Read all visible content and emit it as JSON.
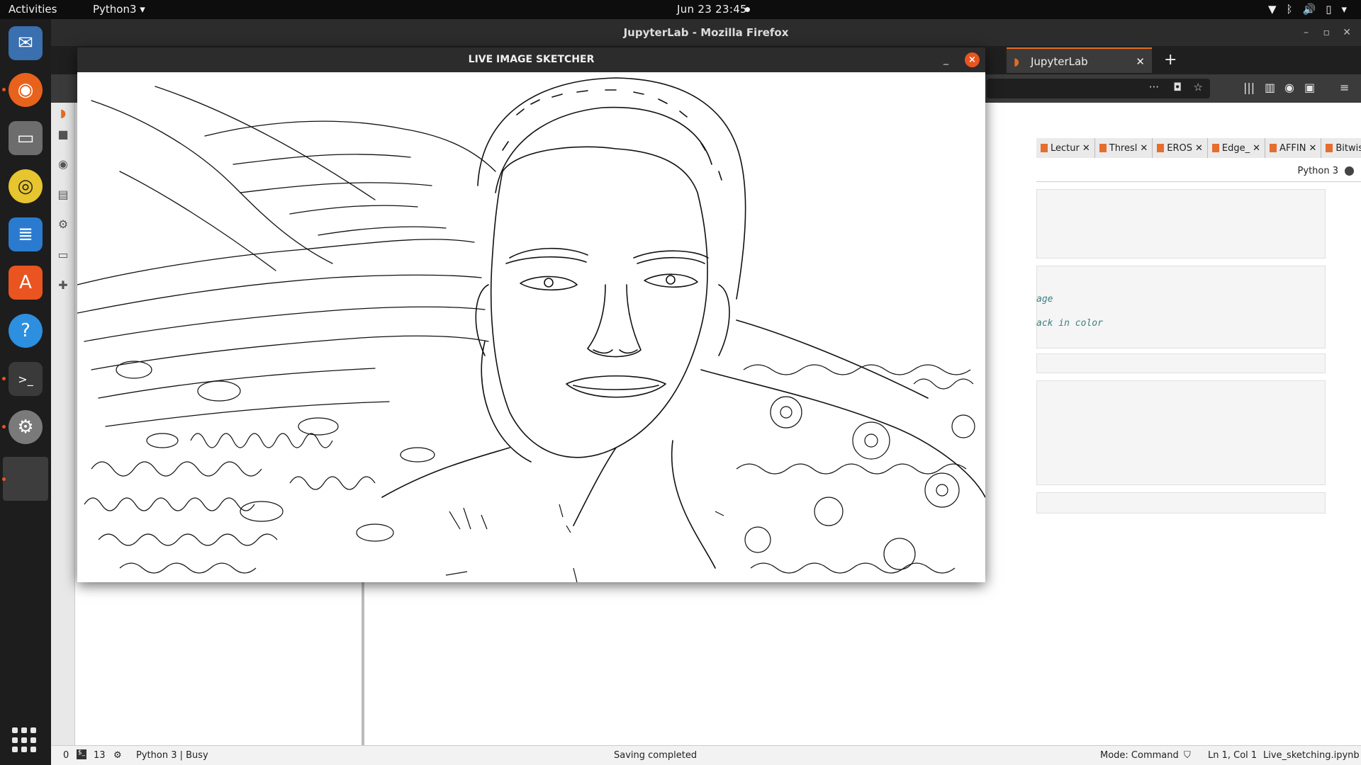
{
  "topbar": {
    "activities": "Activities",
    "app": "Python3 ▾",
    "clock": "Jun 23  23:45"
  },
  "dock": {
    "apps": [
      "thunderbird-icon",
      "firefox-icon",
      "files-icon",
      "rhythmbox-icon",
      "writer-icon",
      "software-icon",
      "help-icon",
      "terminal-icon",
      "settings-icon",
      "blank-window-icon"
    ]
  },
  "firefox": {
    "title": "JupyterLab - Mozilla Firefox",
    "tabs": [
      {
        "label": "JupyterLab"
      }
    ],
    "new_tab": "+"
  },
  "jupyter": {
    "doc_tabs": [
      "Lectur",
      "Thresl",
      "EROS",
      "Edge_",
      "AFFIN",
      "Bitwis"
    ],
    "kernel_label": "Python 3",
    "code_lines": [
      "age",
      "ack in color"
    ]
  },
  "statusbar": {
    "num1": "0",
    "num2": "13",
    "kernel_status": "Python 3 | Busy",
    "message": "Saving completed",
    "mode": "Mode: Command",
    "position": "Ln 1, Col 1",
    "filename": "Live_sketching.ipynb"
  },
  "sketch": {
    "title": "LIVE IMAGE SKETCHER",
    "minimize": "_",
    "close": "×"
  }
}
